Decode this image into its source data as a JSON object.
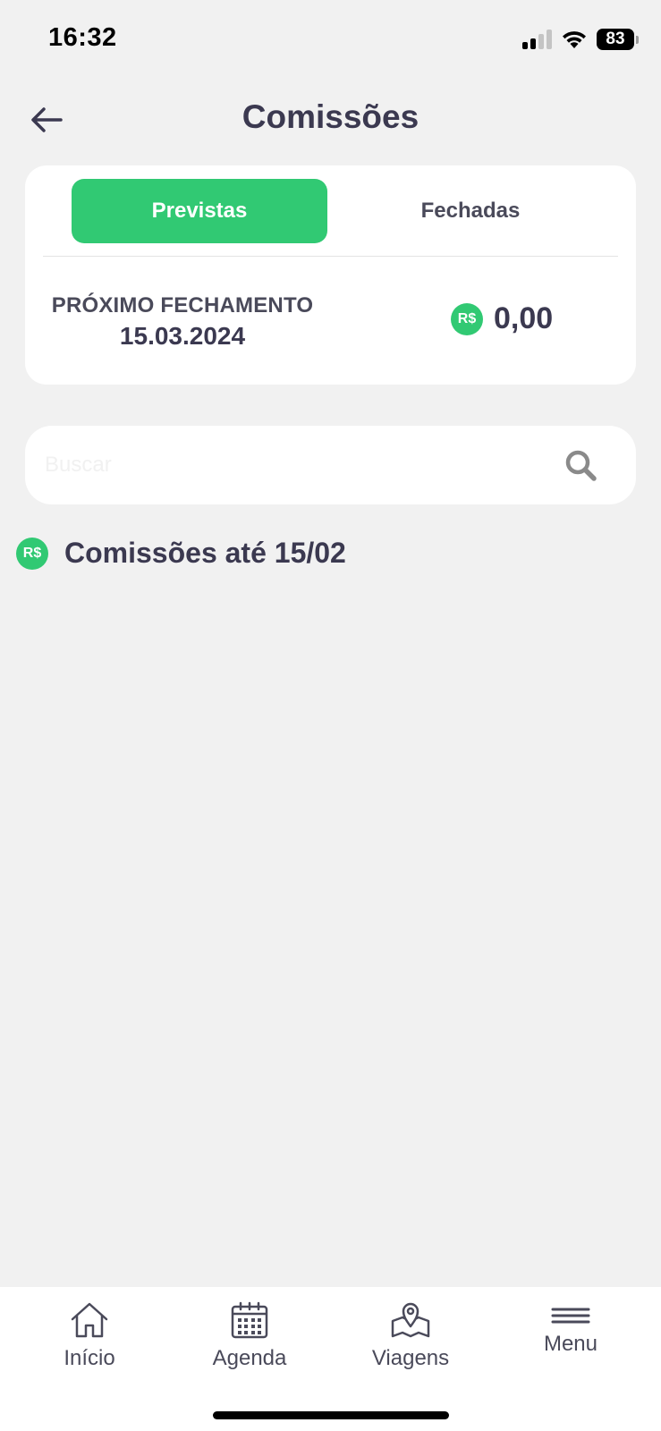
{
  "status_bar": {
    "time": "16:32",
    "battery": "83"
  },
  "header": {
    "title": "Comissões"
  },
  "tabs": [
    {
      "label": "Previstas",
      "active": true
    },
    {
      "label": "Fechadas",
      "active": false
    }
  ],
  "summary": {
    "next_close_label": "PRÓXIMO FECHAMENTO",
    "next_close_date": "15.03.2024",
    "currency_badge": "R$",
    "amount": "0,00"
  },
  "search": {
    "placeholder": "Buscar",
    "value": ""
  },
  "section": {
    "badge": "R$",
    "title": "Comissões até 15/02"
  },
  "bottom_nav": [
    {
      "label": "Início",
      "icon": "home-icon"
    },
    {
      "label": "Agenda",
      "icon": "calendar-icon"
    },
    {
      "label": "Viagens",
      "icon": "map-pin-icon"
    },
    {
      "label": "Menu",
      "icon": "menu-icon"
    }
  ],
  "colors": {
    "accent": "#31c973",
    "text": "#3b3950",
    "background": "#f1f1f1"
  }
}
